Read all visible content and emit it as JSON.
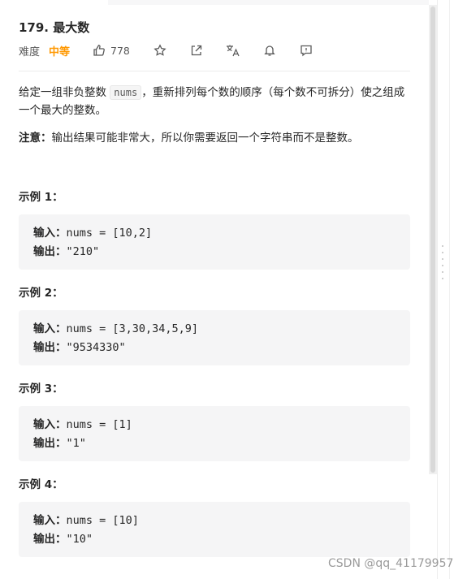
{
  "problem": {
    "title": "179. 最大数",
    "difficulty_label": "难度",
    "difficulty": "中等",
    "likes": "778"
  },
  "description": {
    "part1": "给定一组非负整数 ",
    "code": "nums",
    "part2": "，重新排列每个数的顺序（每个数不可拆分）使之组成一个最大的整数。"
  },
  "note": {
    "label": "注意：",
    "text": "输出结果可能非常大，所以你需要返回一个字符串而不是整数。"
  },
  "examples": [
    {
      "title": "示例 1：",
      "input_label": "输入：",
      "input": "nums = [10,2]",
      "output_label": "输出：",
      "output": "\"210\""
    },
    {
      "title": "示例 2：",
      "input_label": "输入：",
      "input": "nums = [3,30,34,5,9]",
      "output_label": "输出：",
      "output": "\"9534330\""
    },
    {
      "title": "示例 3：",
      "input_label": "输入：",
      "input": "nums = [1]",
      "output_label": "输出：",
      "output": "\"1\""
    },
    {
      "title": "示例 4：",
      "input_label": "输入：",
      "input": "nums = [10]",
      "output_label": "输出：",
      "output": "\"10\""
    }
  ],
  "icons": [
    "thumbs-up-icon",
    "star-icon",
    "share-icon",
    "translate-icon",
    "bell-icon",
    "feedback-icon"
  ],
  "colors": {
    "difficulty_medium": "#ff9800",
    "code_bg": "#f5f5f6"
  },
  "watermark": "CSDN @qq_41179957"
}
